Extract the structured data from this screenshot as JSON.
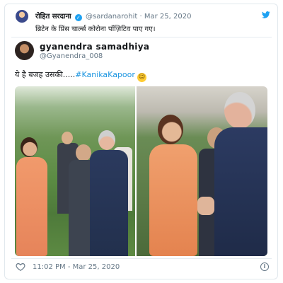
{
  "quoted_tweet": {
    "name": "रोहित सरदाना",
    "handle": "@sardanarohit",
    "separator": "·",
    "date": "Mar 25, 2020",
    "text": "ब्रिटेन के प्रिंस चार्ल्स कोरोना पॉज़िटिव पाए गए।"
  },
  "main_tweet": {
    "name": "gyanendra samadhiya",
    "handle": "@Gyanendra_008",
    "text_prefix": "ये है बजह उसकी.....",
    "hashtag": "#KanikaKapoor",
    "emoji": "😃"
  },
  "footer": {
    "timestamp": "11:02 PM - Mar 25, 2020"
  },
  "colors": {
    "link": "#1b95e0",
    "twitter_blue": "#1da1f2",
    "muted": "#657786"
  }
}
